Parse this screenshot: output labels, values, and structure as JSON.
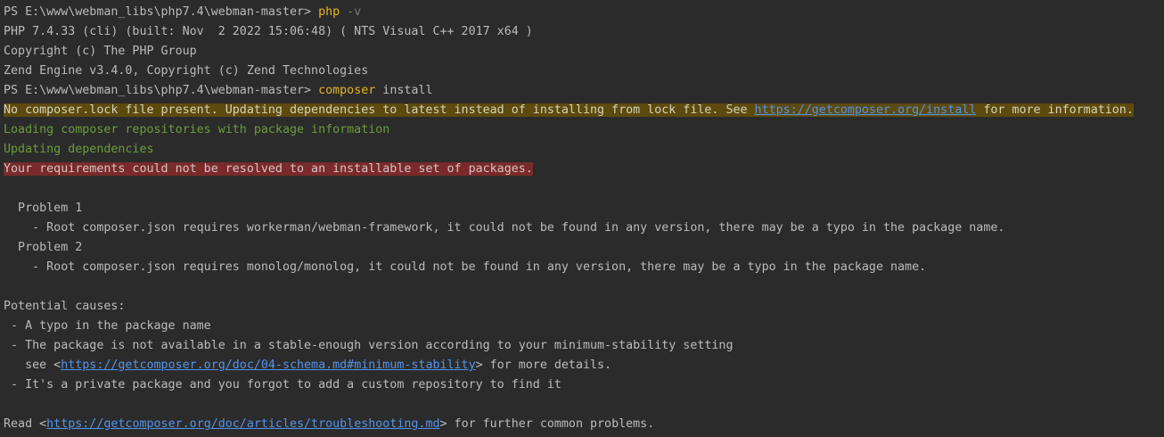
{
  "terminal": {
    "prompt1": "PS E:\\www\\webman_libs\\php7.4\\webman-master> ",
    "cmd1": "php",
    "cmd1_arg": " -v",
    "php_version": "PHP 7.4.33 (cli) (built: Nov  2 2022 15:06:48) ( NTS Visual C++ 2017 x64 )",
    "php_copyright": "Copyright (c) The PHP Group",
    "zend": "Zend Engine v3.4.0, Copyright (c) Zend Technologies",
    "prompt2": "PS E:\\www\\webman_libs\\php7.4\\webman-master> ",
    "cmd2": "composer",
    "cmd2_arg": " install",
    "warn_pre": "No composer.lock file present. Updating dependencies to latest instead of installing from lock file. See ",
    "warn_link": "https://getcomposer.org/install",
    "warn_post": " for more information.",
    "loading": "Loading composer repositories with package information",
    "updating": "Updating dependencies",
    "error": "Your requirements could not be resolved to an installable set of packages.",
    "problem1_title": "  Problem 1",
    "problem1_detail": "    - Root composer.json requires workerman/webman-framework, it could not be found in any version, there may be a typo in the package name.",
    "problem2_title": "  Problem 2",
    "problem2_detail": "    - Root composer.json requires monolog/monolog, it could not be found in any version, there may be a typo in the package name.",
    "causes_title": "Potential causes:",
    "cause1": " - A typo in the package name",
    "cause2": " - The package is not available in a stable-enough version according to your minimum-stability setting",
    "cause2_see_pre": "   see <",
    "cause2_link": "https://getcomposer.org/doc/04-schema.md#minimum-stability",
    "cause2_see_post": "> for more details.",
    "cause3": " - It's a private package and you forgot to add a custom repository to find it",
    "read_pre": "Read <",
    "read_link": "https://getcomposer.org/doc/articles/troubleshooting.md",
    "read_post": "> for further common problems."
  }
}
